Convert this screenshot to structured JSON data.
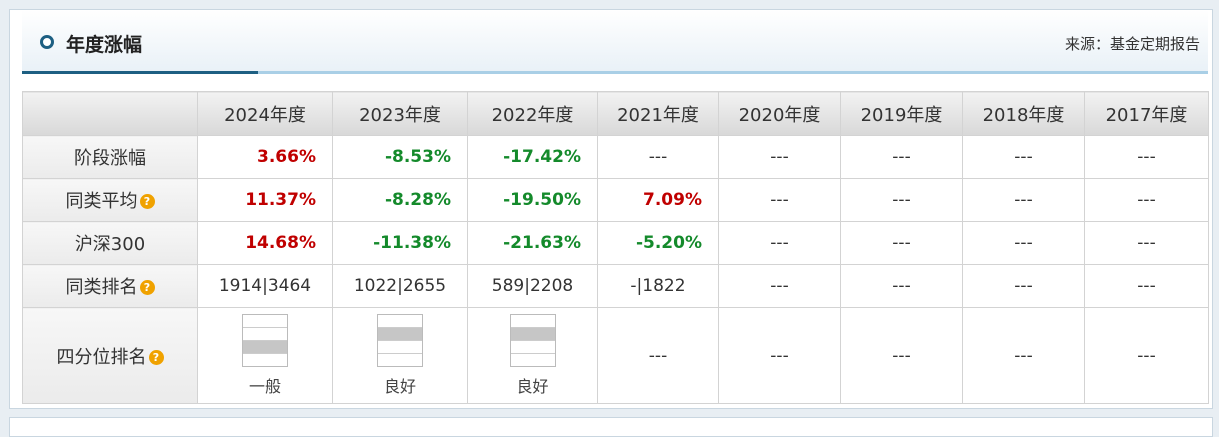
{
  "header": {
    "title": "年度涨幅",
    "source": "来源：基金定期报告"
  },
  "table": {
    "columns": [
      "2024年度",
      "2023年度",
      "2022年度",
      "2021年度",
      "2020年度",
      "2019年度",
      "2018年度",
      "2017年度"
    ],
    "rows": [
      {
        "label": "阶段涨幅",
        "help": false,
        "cells": [
          {
            "text": "3.66%",
            "cls": "red"
          },
          {
            "text": "-8.53%",
            "cls": "green"
          },
          {
            "text": "-17.42%",
            "cls": "green"
          },
          {
            "text": "---"
          },
          {
            "text": "---"
          },
          {
            "text": "---"
          },
          {
            "text": "---"
          },
          {
            "text": "---"
          }
        ]
      },
      {
        "label": "同类平均",
        "help": true,
        "cells": [
          {
            "text": "11.37%",
            "cls": "red"
          },
          {
            "text": "-8.28%",
            "cls": "green"
          },
          {
            "text": "-19.50%",
            "cls": "green"
          },
          {
            "text": "7.09%",
            "cls": "red"
          },
          {
            "text": "---"
          },
          {
            "text": "---"
          },
          {
            "text": "---"
          },
          {
            "text": "---"
          }
        ]
      },
      {
        "label": "沪深300",
        "help": false,
        "cells": [
          {
            "text": "14.68%",
            "cls": "red"
          },
          {
            "text": "-11.38%",
            "cls": "green"
          },
          {
            "text": "-21.63%",
            "cls": "green"
          },
          {
            "text": "-5.20%",
            "cls": "green"
          },
          {
            "text": "---"
          },
          {
            "text": "---"
          },
          {
            "text": "---"
          },
          {
            "text": "---"
          }
        ]
      },
      {
        "label": "同类排名",
        "help": true,
        "cells": [
          {
            "text": "1914|3464"
          },
          {
            "text": "1022|2655"
          },
          {
            "text": "589|2208"
          },
          {
            "text": "-|1822"
          },
          {
            "text": "---"
          },
          {
            "text": "---"
          },
          {
            "text": "---"
          },
          {
            "text": "---"
          }
        ]
      }
    ],
    "quartile_row": {
      "label": "四分位排名",
      "cells": [
        {
          "level": 3,
          "text": "一般"
        },
        {
          "level": 2,
          "text": "良好"
        },
        {
          "level": 2,
          "text": "良好"
        },
        {
          "text": "---"
        },
        {
          "text": "---"
        },
        {
          "text": "---"
        },
        {
          "text": "---"
        },
        {
          "text": "---"
        }
      ]
    }
  },
  "icons": {
    "help": "question-mark-icon"
  },
  "colors": {
    "positive": "#c00000",
    "negative": "#148a2b",
    "accent": "#1d5f82"
  }
}
